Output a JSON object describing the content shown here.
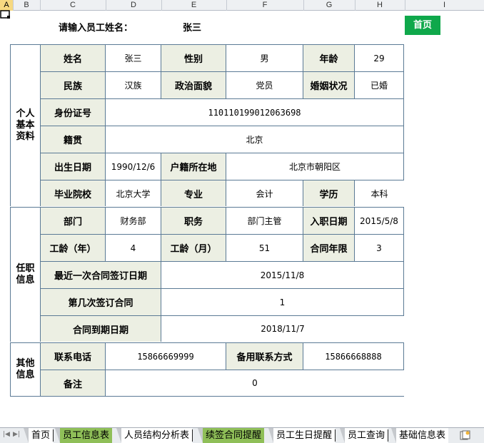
{
  "sheet": {
    "columns": [
      "A",
      "B",
      "C",
      "D",
      "E",
      "F",
      "G",
      "H",
      "I"
    ],
    "selected_column": "A"
  },
  "header": {
    "prompt_label": "请输入员工姓名：",
    "employee_name": "张三",
    "home_button": "首页"
  },
  "sections": {
    "personal": "个人\n基本\n资料",
    "employment": "任职\n信息",
    "other": "其他\n信息"
  },
  "personal": {
    "name_label": "姓名",
    "name": "张三",
    "gender_label": "性别",
    "gender": "男",
    "age_label": "年龄",
    "age": "29",
    "ethnicity_label": "民族",
    "ethnicity": "汉族",
    "politics_label": "政治面貌",
    "politics": "党员",
    "marital_label": "婚姻状况",
    "marital": "已婚",
    "id_label": "身份证号",
    "id": "110110199012063698",
    "origin_label": "籍贯",
    "origin": "北京",
    "birth_label": "出生日期",
    "birth": "1990/12/6",
    "hukou_label": "户籍所在地",
    "hukou": "北京市朝阳区",
    "school_label": "毕业院校",
    "school": "北京大学",
    "major_label": "专业",
    "major": "会计",
    "degree_label": "学历",
    "degree": "本科"
  },
  "employment": {
    "dept_label": "部门",
    "dept": "财务部",
    "position_label": "职务",
    "position": "部门主管",
    "hire_label": "入职日期",
    "hire": "2015/5/8",
    "years_label": "工龄（年）",
    "years": "4",
    "months_label": "工龄（月）",
    "months": "51",
    "contract_term_label": "合同年限",
    "contract_term": "3",
    "last_contract_label": "最近一次合同签订日期",
    "last_contract": "2015/11/8",
    "contract_count_label": "第几次签订合同",
    "contract_count": "1",
    "expire_label": "合同到期日期",
    "expire": "2018/11/7"
  },
  "other": {
    "phone_label": "联系电话",
    "phone": "15866669999",
    "alt_phone_label": "备用联系方式",
    "alt_phone": "15866668888",
    "note_label": "备注",
    "note": "0"
  },
  "tabs": [
    "首页",
    "员工信息表",
    "人员结构分析表",
    "续签合同提醒",
    "员工生日提醒",
    "员工查询",
    "基础信息表"
  ],
  "colors": {
    "home_button": "#0fa84b",
    "label_fill": "#ecefe3",
    "border": "#5b7a95",
    "tab_green": "#8fbf58",
    "selected_column": "#f7d981"
  }
}
